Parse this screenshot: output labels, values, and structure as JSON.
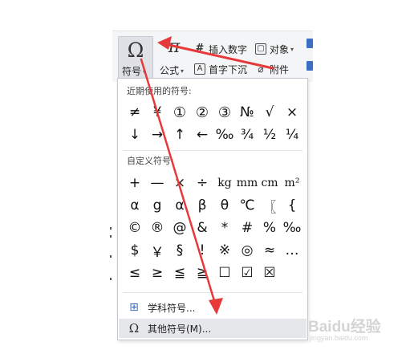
{
  "ribbon": {
    "symbol_glyph": "Ω",
    "symbol_label": "符号",
    "formula_glyph": "π",
    "formula_label": "公式",
    "insert_number": "插入数字",
    "object": "对象",
    "drop_cap": "首字下沉",
    "attachment": "附件",
    "caret": "▾"
  },
  "panel": {
    "recent_title": "近期使用的符号:",
    "recent_symbols": [
      "≠",
      "¥",
      "①",
      "②",
      "③",
      "№",
      "√",
      "×",
      "↓",
      "→",
      "↑",
      "←",
      "‰",
      "¾",
      "½",
      "¼"
    ],
    "custom_title": "自定义符号:",
    "custom_symbols": [
      "+",
      "—",
      "×",
      "÷",
      "kg",
      "mm",
      "cm",
      "m²",
      "α",
      "g",
      "α",
      "β",
      "θ",
      "℃",
      "〖",
      "{",
      "©",
      "®",
      "@",
      "&",
      "*",
      "#",
      "%",
      "‰",
      "$",
      "￥",
      "§",
      "!",
      "※",
      "◎",
      "≈",
      "…",
      "≤",
      "≥",
      "≦",
      "≧",
      "☐",
      "☑",
      "☒",
      ""
    ],
    "menu": [
      {
        "label": "学科符号...",
        "icon": "subject-symbols-icon"
      },
      {
        "label": "其他符号(M)...",
        "icon": "omega-icon"
      }
    ]
  },
  "watermark": {
    "main": "Baidu经验",
    "sub": "jingyan.baidu.com"
  },
  "colors": {
    "arrow": "#e8393a",
    "accent": "#3a6fc4",
    "hover": "#e6e7ea"
  }
}
